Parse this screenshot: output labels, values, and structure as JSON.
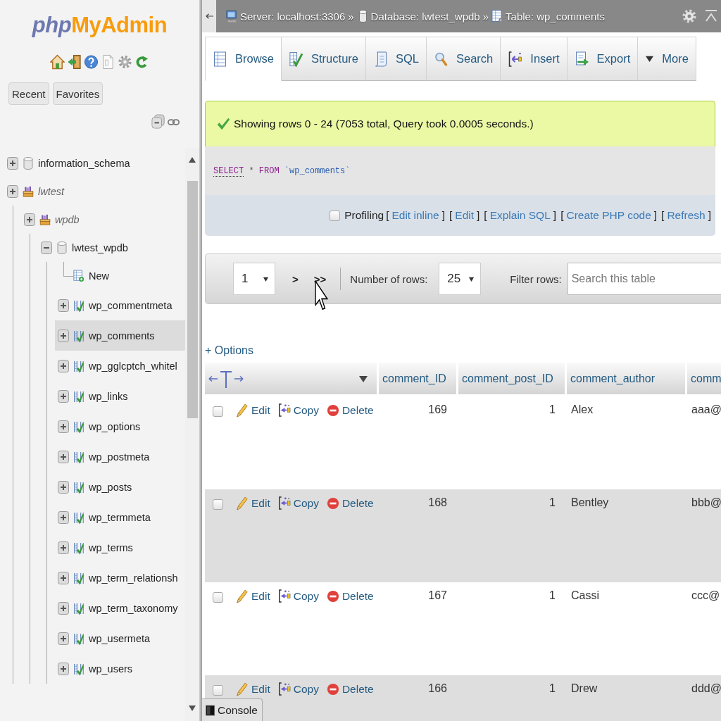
{
  "sidebar": {
    "logo": {
      "part_1": "php",
      "part_2": "MyAdmin"
    },
    "buttons": [
      "Recent",
      "Favorites"
    ],
    "tree": [
      {
        "label": "information_schema",
        "kind": "database",
        "expanded": false,
        "selected": false
      },
      {
        "label": "lwtest",
        "kind": "group",
        "expanded": false,
        "selected": false,
        "children": [
          {
            "label": "wpdb",
            "kind": "group",
            "expanded": false,
            "selected": false,
            "children": [
              {
                "label": "lwtest_wpdb",
                "kind": "database",
                "expanded": true,
                "selected": false,
                "children": [
                  {
                    "label": "New",
                    "kind": "new",
                    "selected": false
                  },
                  {
                    "label": "wp_commentmeta",
                    "kind": "table",
                    "expanded": false,
                    "selected": false
                  },
                  {
                    "label": "wp_comments",
                    "kind": "table",
                    "expanded": false,
                    "selected": true
                  },
                  {
                    "label": "wp_gglcptch_whitel",
                    "kind": "table",
                    "expanded": false,
                    "selected": false
                  },
                  {
                    "label": "wp_links",
                    "kind": "table",
                    "expanded": false,
                    "selected": false
                  },
                  {
                    "label": "wp_options",
                    "kind": "table",
                    "expanded": false,
                    "selected": false
                  },
                  {
                    "label": "wp_postmeta",
                    "kind": "table",
                    "expanded": false,
                    "selected": false
                  },
                  {
                    "label": "wp_posts",
                    "kind": "table",
                    "expanded": false,
                    "selected": false
                  },
                  {
                    "label": "wp_termmeta",
                    "kind": "table",
                    "expanded": false,
                    "selected": false
                  },
                  {
                    "label": "wp_terms",
                    "kind": "table",
                    "expanded": false,
                    "selected": false
                  },
                  {
                    "label": "wp_term_relationsh",
                    "kind": "table",
                    "expanded": false,
                    "selected": false
                  },
                  {
                    "label": "wp_term_taxonomy",
                    "kind": "table",
                    "expanded": false,
                    "selected": false
                  },
                  {
                    "label": "wp_usermeta",
                    "kind": "table",
                    "expanded": false,
                    "selected": false
                  },
                  {
                    "label": "wp_users",
                    "kind": "table",
                    "expanded": false,
                    "selected": false
                  }
                ]
              }
            ]
          }
        ]
      }
    ]
  },
  "main": {
    "breadcrumb": [
      {
        "kind": "server",
        "label": "Server: localhost:3306"
      },
      {
        "kind": "separator",
        "label": "»"
      },
      {
        "kind": "database",
        "label": "Database: lwtest_wpdb"
      },
      {
        "kind": "separator",
        "label": "»"
      },
      {
        "kind": "table",
        "label": "Table: wp_comments"
      }
    ],
    "tabs": [
      {
        "label": "Browse",
        "kind": "browse",
        "selected": true
      },
      {
        "label": "Structure",
        "kind": "structure",
        "selected": false
      },
      {
        "label": "SQL",
        "kind": "sql",
        "selected": false
      },
      {
        "label": "Search",
        "kind": "search",
        "selected": false
      },
      {
        "label": "Insert",
        "kind": "insert",
        "selected": false
      },
      {
        "label": "Export",
        "kind": "export",
        "selected": false
      },
      {
        "label": "More",
        "kind": "more",
        "selected": false
      }
    ],
    "message": "Showing rows 0 - 24 (7053 total, Query took 0.0005 seconds.)",
    "sql_query": [
      {
        "kind": "keyword_link",
        "text": "SELECT"
      },
      {
        "kind": "operator",
        "text": "*"
      },
      {
        "kind": "keyword",
        "text": "FROM"
      },
      {
        "kind": "identifier",
        "text": "`wp_comments`"
      }
    ],
    "profiling": {
      "label": "Profiling",
      "checked": false
    },
    "query_links": [
      {
        "open": "[",
        "label": "Edit inline",
        "close": "]"
      },
      {
        "open": "[",
        "label": "Edit",
        "close": "]"
      },
      {
        "open": "[",
        "label": "Explain SQL",
        "close": "]"
      },
      {
        "open": "[",
        "label": "Create PHP code",
        "close": "]"
      },
      {
        "open": "[",
        "label": "Refresh",
        "close": "]"
      }
    ],
    "navigation": {
      "page_select": {
        "value": "1"
      },
      "next_button": ">",
      "last_button": ">>",
      "rows_select": {
        "label": "Number of rows:",
        "value": "25"
      },
      "filter": {
        "label": "Filter rows:",
        "placeholder": "Search this table"
      }
    },
    "table": {
      "options_link": "+ Options",
      "columns": [
        {
          "label": "comment_ID",
          "kind": "number"
        },
        {
          "label": "comment_post_ID",
          "kind": "number"
        },
        {
          "label": "comment_author",
          "kind": "text"
        },
        {
          "label": "comm",
          "kind": "text"
        }
      ],
      "rows": [
        {
          "checked": false,
          "actions": [
            {
              "kind": "edit",
              "label": "Edit"
            },
            {
              "kind": "copy",
              "label": "Copy"
            },
            {
              "kind": "delete",
              "label": "Delete"
            }
          ],
          "cells": [
            "169",
            "1",
            "Alex",
            "aaa@"
          ]
        },
        {
          "checked": false,
          "actions": [
            {
              "kind": "edit",
              "label": "Edit"
            },
            {
              "kind": "copy",
              "label": "Copy"
            },
            {
              "kind": "delete",
              "label": "Delete"
            }
          ],
          "cells": [
            "168",
            "1",
            "Bentley",
            "bbb@"
          ]
        },
        {
          "checked": false,
          "actions": [
            {
              "kind": "edit",
              "label": "Edit"
            },
            {
              "kind": "copy",
              "label": "Copy"
            },
            {
              "kind": "delete",
              "label": "Delete"
            }
          ],
          "cells": [
            "167",
            "1",
            "Cassi",
            "ccc@"
          ]
        },
        {
          "checked": false,
          "actions": [
            {
              "kind": "edit",
              "label": "Edit"
            },
            {
              "kind": "copy",
              "label": "Copy"
            },
            {
              "kind": "delete",
              "label": "Delete"
            }
          ],
          "cells": [
            "166",
            "1",
            "Drew",
            "ddd@"
          ]
        }
      ]
    },
    "console": {
      "label": "Console"
    }
  }
}
